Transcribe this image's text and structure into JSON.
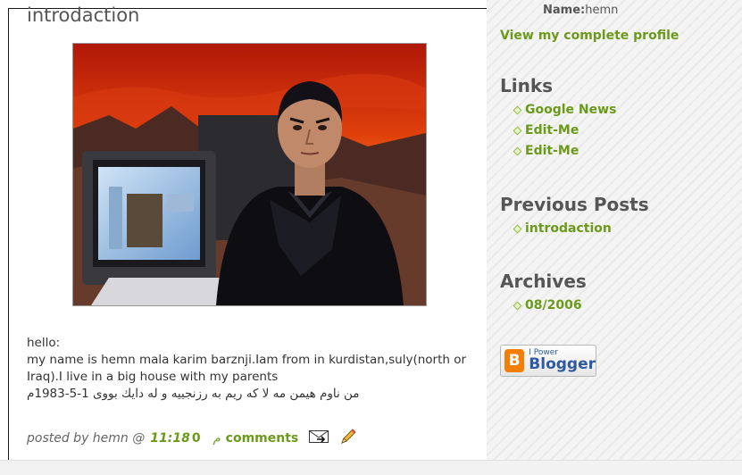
{
  "post": {
    "title": "introdaction",
    "body": {
      "line1": "hello:",
      "line2": "my name is hemn mala karim barznji.Iam from in kurdistan,suly(north or Iraq).I live in a big house with my parents",
      "line3": "من ناوم هیمن مه لا که ریم به رزنجییه و له دایك بووی 1-5-1983م"
    },
    "footer": {
      "posted_by": "posted by hemn @",
      "time": "11:18",
      "comment_count": "0",
      "marker": "م",
      "comments_label": "comments",
      "email_icon": "email-post-icon",
      "edit_icon": "pencil-edit-icon"
    }
  },
  "sidebar": {
    "profile": {
      "name_label": "Name:",
      "name_value": "hemn",
      "complete_profile_link": "View my complete profile"
    },
    "links_heading": "Links",
    "links": [
      "Google News",
      "Edit-Me",
      "Edit-Me"
    ],
    "previous_posts_heading": "Previous Posts",
    "previous_posts": [
      "introdaction"
    ],
    "archives_heading": "Archives",
    "archives": [
      "08/2006"
    ],
    "badge": {
      "logo_letter": "B",
      "small_text": "I Power",
      "big_text": "Blogger"
    }
  },
  "colors": {
    "link_green": "#6b9a1b",
    "heading_gray": "#555555",
    "blogger_orange": "#f57d00"
  }
}
